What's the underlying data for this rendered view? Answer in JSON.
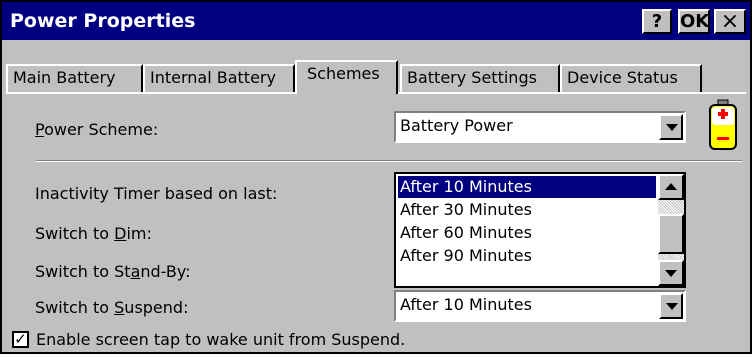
{
  "window": {
    "title": "Power Properties",
    "help_label": "?",
    "ok_label": "OK",
    "close_label": "×"
  },
  "tabs": [
    {
      "label": "Main Battery",
      "active": false
    },
    {
      "label": "Internal Battery",
      "active": false
    },
    {
      "label": "Schemes",
      "active": true
    },
    {
      "label": "Battery Settings",
      "active": false
    },
    {
      "label": "Device Status",
      "active": false
    }
  ],
  "power_scheme": {
    "label_prefix": "P",
    "label_rest": "ower Scheme:",
    "value": "Battery Power",
    "icon": "battery-icon"
  },
  "settings": {
    "inactivity_label": "Inactivity Timer based on last:",
    "dim_prefix": "Switch to ",
    "dim_hot": "D",
    "dim_rest": "im:",
    "standby_prefix": "Switch to St",
    "standby_hot": "a",
    "standby_rest": "nd-By:",
    "suspend_prefix": "Switch to ",
    "suspend_hot": "S",
    "suspend_rest": "uspend:"
  },
  "dropdown_list": {
    "options": [
      "After 10 Minutes",
      "After 30 Minutes",
      "After 60 Minutes",
      "After 90 Minutes"
    ],
    "selected": "After 10 Minutes"
  },
  "suspend_value": "After 10 Minutes",
  "wake_checkbox": {
    "checked": true,
    "label": "Enable screen tap to wake unit from Suspend."
  },
  "colors": {
    "titlebar": "#000080",
    "face": "#c0c0c0",
    "selection": "#000080"
  }
}
